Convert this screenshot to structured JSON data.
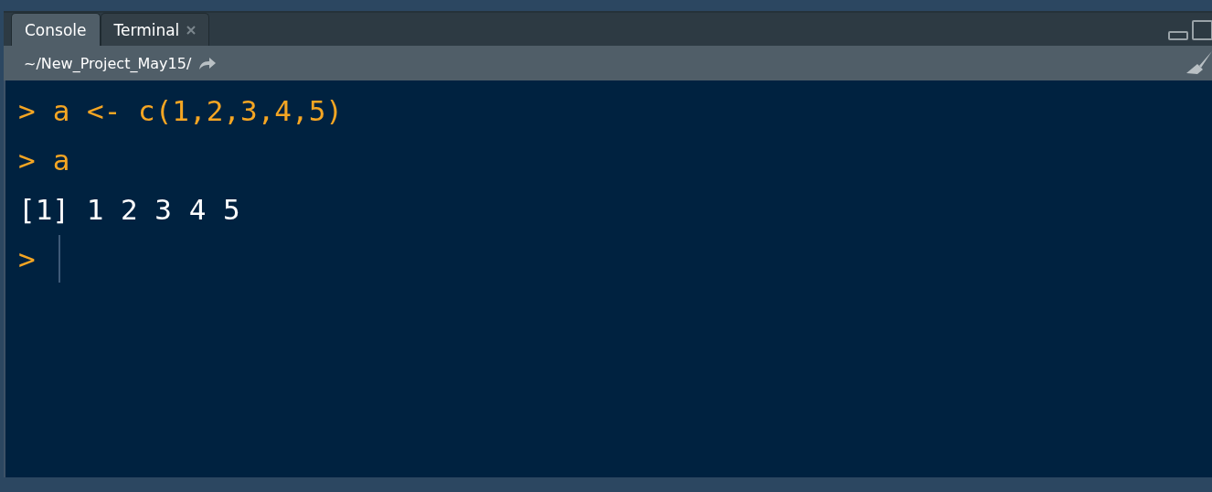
{
  "tabs": [
    {
      "label": "Console",
      "selected": true,
      "closable": false
    },
    {
      "label": "Terminal",
      "selected": false,
      "closable": true
    }
  ],
  "path": "~/New_Project_May15/",
  "console": [
    {
      "kind": "input",
      "prompt": ">",
      "text": "a <- c(1,2,3,4,5)"
    },
    {
      "kind": "input",
      "prompt": ">",
      "text": "a"
    },
    {
      "kind": "output",
      "text": "[1] 1 2 3 4 5"
    },
    {
      "kind": "prompt",
      "prompt": ">"
    }
  ]
}
